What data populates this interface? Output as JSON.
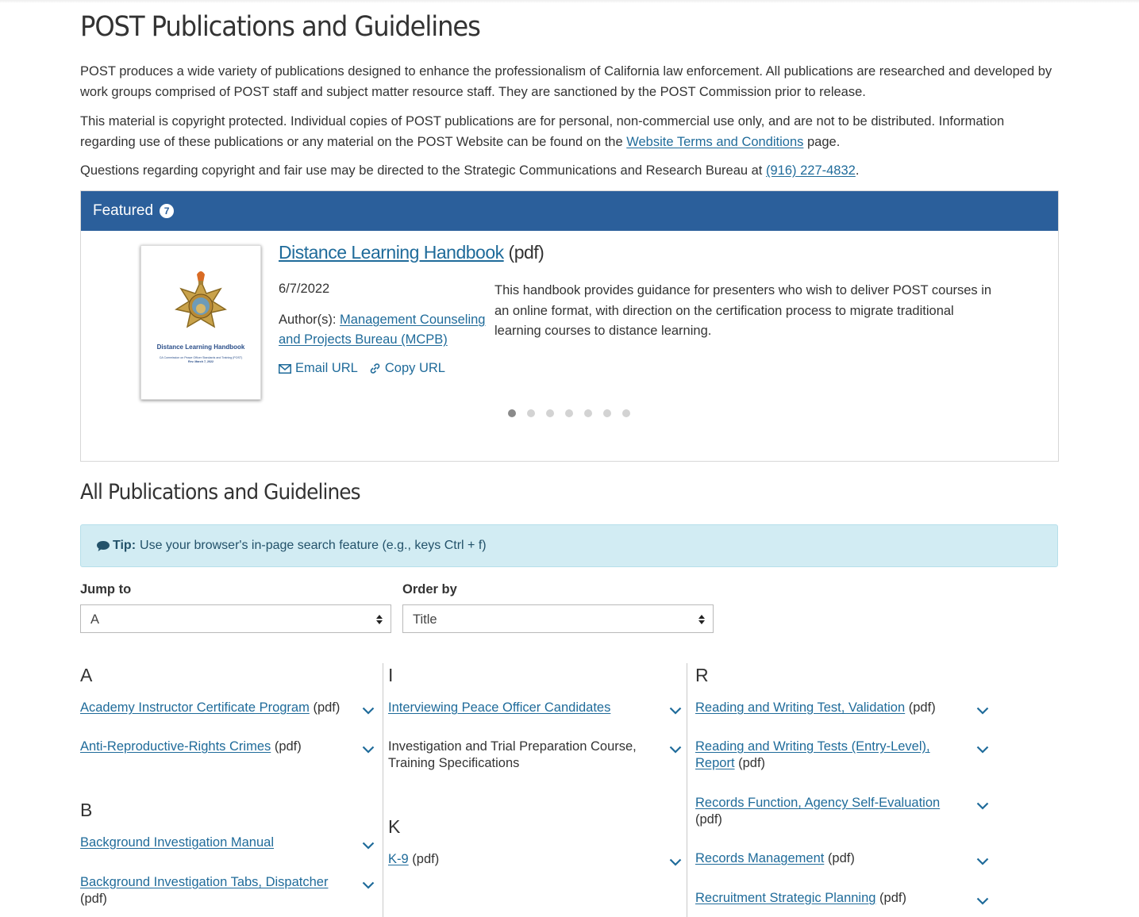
{
  "page": {
    "title": "POST Publications and Guidelines",
    "intro_1": "POST produces a wide variety of publications designed to enhance the professionalism of California law enforcement. All publications are researched and developed by work groups comprised of POST staff and subject matter resource staff.  They are sanctioned by the POST Commission prior to release.",
    "intro_2_before": "This material is copyright protected. Individual copies of POST publications are for personal, non-commercial use only, and are not to be distributed.  Information regarding use of these publications or any material on the POST Website can be found on the ",
    "intro_2_link": "Website Terms and Conditions",
    "intro_2_after": " page.",
    "intro_3_before": "Questions regarding copyright and fair use may be directed to the Strategic Communications and Research Bureau at ",
    "intro_3_phone": "(916) 227-4832",
    "intro_3_after": "."
  },
  "featured": {
    "heading": "Featured",
    "count": "7",
    "cover_title": "Distance Learning Handbook",
    "cover_sub_1": "CA Commission on Peace Officer Standards and Training (POST)",
    "cover_sub_2": "Rev. March 7, 2022",
    "title_link": "Distance Learning Handbook",
    "title_suffix": " (pdf)",
    "date": "6/7/2022",
    "author_label": "Author(s): ",
    "author_link": "Management Counseling and Projects Bureau (MCPB)",
    "email_label": "Email URL",
    "copy_label": "Copy URL",
    "description": "This handbook provides guidance for presenters who wish to deliver POST courses in an online format, with direction on the certification process to migrate traditional learning courses to distance learning.",
    "active_slide": 1,
    "total_slides": 7
  },
  "all": {
    "title": "All Publications and Guidelines",
    "tip_label": "Tip:",
    "tip_text": "Use your browser's in-page search feature (e.g., keys Ctrl + f)",
    "jump_label": "Jump to",
    "jump_value": "A",
    "order_label": "Order by",
    "order_value": "Title"
  },
  "columns": [
    {
      "sections": [
        {
          "letter": "A",
          "items": [
            {
              "link": "Academy Instructor Certificate Program",
              "suffix": " (pdf)"
            },
            {
              "link": "Anti-Reproductive-Rights Crimes",
              "suffix": " (pdf)"
            }
          ]
        },
        {
          "letter": "B",
          "items": [
            {
              "link": "Background Investigation Manual",
              "suffix": ""
            },
            {
              "link": "Background Investigation Tabs, Dispatcher",
              "suffix": " (pdf)"
            }
          ]
        }
      ]
    },
    {
      "sections": [
        {
          "letter": "I",
          "items": [
            {
              "link": "Interviewing Peace Officer Candidates",
              "suffix": ""
            },
            {
              "link": "",
              "suffix": "Investigation and Trial Preparation Course, Training Specifications"
            }
          ]
        },
        {
          "letter": "K",
          "items": [
            {
              "link": "K-9",
              "suffix": " (pdf)"
            }
          ]
        }
      ]
    },
    {
      "sections": [
        {
          "letter": "R",
          "items": [
            {
              "link": "Reading and Writing Test, Validation",
              "suffix": " (pdf)"
            },
            {
              "link": "Reading and Writing Tests (Entry-Level), Report",
              "suffix": " (pdf)"
            },
            {
              "link": "Records Function, Agency Self-Evaluation",
              "suffix": " (pdf)"
            },
            {
              "link": "Records Management",
              "suffix": " (pdf)"
            },
            {
              "link": "Recruitment Strategic Planning",
              "suffix": " (pdf)"
            }
          ]
        }
      ]
    }
  ],
  "colors": {
    "link": "#1f6b9a",
    "featured_header": "#2b5f9b",
    "tip_bg": "#d2ecf3"
  }
}
